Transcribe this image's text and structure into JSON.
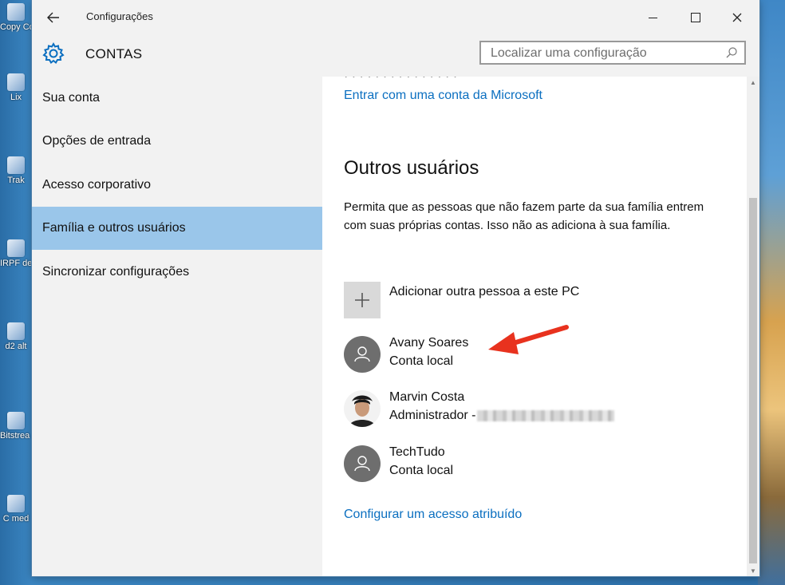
{
  "window": {
    "title": "Configurações",
    "header_title": "CONTAS"
  },
  "search": {
    "placeholder": "Localizar uma configuração"
  },
  "sidebar": {
    "items": [
      {
        "label": "Sua conta"
      },
      {
        "label": "Opções de entrada"
      },
      {
        "label": "Acesso corporativo"
      },
      {
        "label": "Família e outros usuários",
        "active": true
      },
      {
        "label": "Sincronizar configurações"
      }
    ]
  },
  "content": {
    "cut_text": "· · · · · · · · · · · · · · ·",
    "ms_account_link": "Entrar com uma conta da Microsoft",
    "section_title": "Outros usuários",
    "description": "Permita que as pessoas que não fazem parte da sua família entrem com suas próprias contas. Isso não as adiciona à sua família.",
    "add_person": "Adicionar outra pessoa a este PC",
    "users": [
      {
        "name": "Avany Soares",
        "type": "Conta local",
        "avatar": "person-icon"
      },
      {
        "name": "Marvin Costa",
        "type": "Administrador -",
        "avatar": "photo"
      },
      {
        "name": "TechTudo",
        "type": "Conta local",
        "avatar": "person-icon"
      }
    ],
    "assigned_access_link": "Configurar um acesso atribuído"
  },
  "desktop_icons": [
    {
      "label": "Copy Contro"
    },
    {
      "label": "Lix"
    },
    {
      "label": "Trak"
    },
    {
      "label": "IRPF declara"
    },
    {
      "label": "d2 alt"
    },
    {
      "label": "Bitstrea Navi"
    },
    {
      "label": "C med"
    }
  ],
  "colors": {
    "accent": "#0b6fc0",
    "selected_nav": "#9ac6ea",
    "annotation_arrow": "#e8321e"
  }
}
